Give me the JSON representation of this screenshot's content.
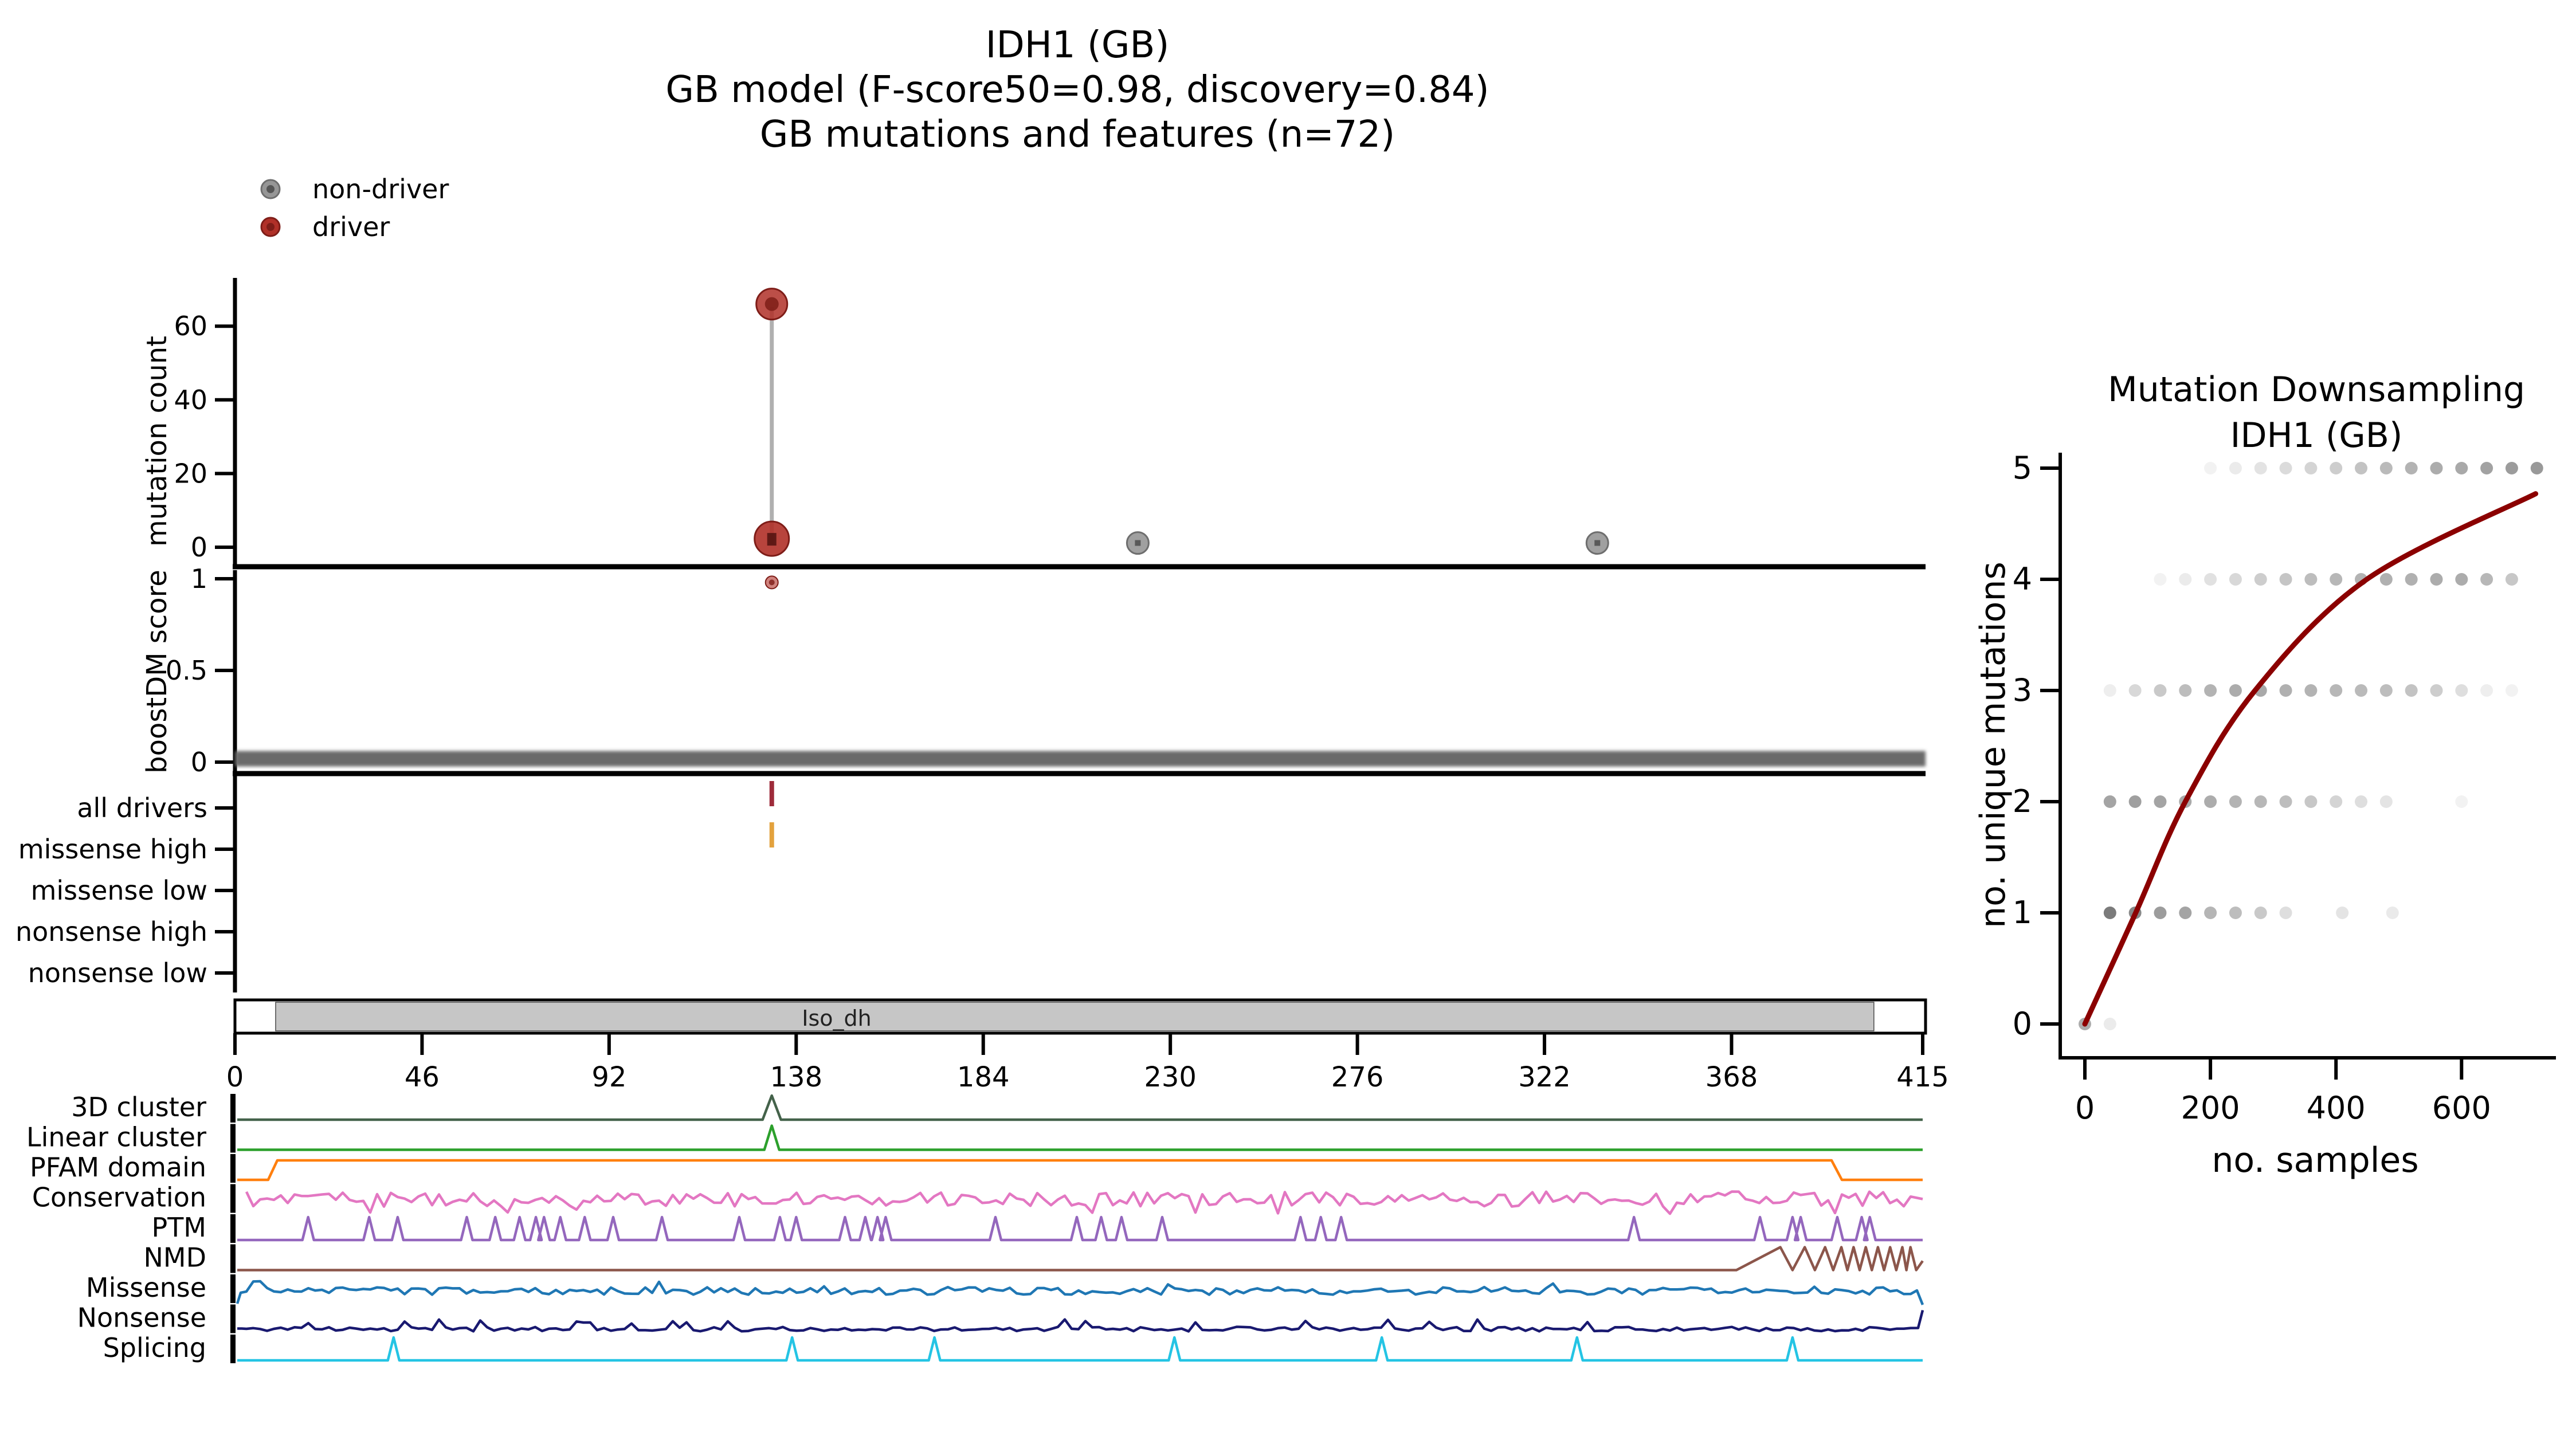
{
  "title": {
    "lines": [
      "IDH1 (GB)",
      "GB model (F-score50=0.98, discovery=0.84)",
      "GB mutations and features (n=72)"
    ]
  },
  "legend": {
    "items": [
      {
        "label": "non-driver",
        "color": "#969696"
      },
      {
        "label": "driver",
        "color": "#b03028"
      }
    ]
  },
  "colors": {
    "driver": "#b03028",
    "driver_dark": "#7e1d18",
    "non_driver": "#969696",
    "stem": "#b0b0b0",
    "score_band": "#6a6a6a",
    "axis": "#000000",
    "domain_fill": "#c6c6c6",
    "downsampling_curve": "#8b0000",
    "downsampling_dot": "#5a5a5a"
  },
  "chart_data": [
    {
      "id": "mutation_count_needle",
      "type": "scatter",
      "ylabel": "mutation count",
      "yticks": [
        0,
        20,
        40,
        60
      ],
      "xlim": [
        0,
        415
      ],
      "driver_points": [
        {
          "pos": 132,
          "count": 66
        },
        {
          "pos": 132,
          "count": 2
        }
      ],
      "nondriver_points": [
        {
          "pos": 222,
          "count": 1
        },
        {
          "pos": 335,
          "count": 1
        }
      ]
    },
    {
      "id": "boostdm_score",
      "type": "scatter",
      "ylabel": "boostDM score",
      "yticks": [
        {
          "label": "0",
          "value": 0
        },
        {
          "label": "0.5",
          "value": 0.5
        },
        {
          "label": "1",
          "value": 1
        }
      ],
      "band": {
        "score": 0.02,
        "color": "#6a6a6a",
        "extent": [
          0,
          415
        ]
      },
      "driver_points": [
        {
          "pos": 132,
          "score": 0.98
        }
      ]
    },
    {
      "id": "observed_mutations",
      "type": "ticks",
      "rows": [
        "all drivers",
        "missense high",
        "missense low",
        "nonsense high",
        "nonsense low"
      ],
      "marks": [
        {
          "row": 0,
          "pos": 132,
          "color": "#9e2b3a"
        },
        {
          "row": 1,
          "pos": 132,
          "color": "#e3a23d"
        }
      ]
    },
    {
      "id": "protein_domain_axis",
      "type": "table",
      "domain": {
        "label": "Iso_dh",
        "start": 10,
        "end": 403
      },
      "xticks": [
        0,
        46,
        92,
        138,
        184,
        230,
        276,
        322,
        368,
        415
      ],
      "xlim": [
        0,
        415
      ]
    },
    {
      "id": "feature_tracks",
      "type": "line",
      "tracks": [
        {
          "name": "3D cluster",
          "color": "#44624a",
          "kind": "spike",
          "spikes": [
            132
          ]
        },
        {
          "name": "Linear cluster",
          "color": "#2ca02c",
          "kind": "spike",
          "spikes": [
            132
          ]
        },
        {
          "name": "PFAM domain",
          "color": "#ff7f0e",
          "kind": "step",
          "step_up": 9,
          "step_down": 394
        },
        {
          "name": "Conservation",
          "color": "#e377c2",
          "kind": "noise",
          "seed": 7,
          "amp": 26
        },
        {
          "name": "PTM",
          "color": "#9467bd",
          "kind": "spikes",
          "spikes": [
            18,
            33,
            40,
            57,
            64,
            70,
            74,
            76,
            80,
            86,
            93,
            105,
            124,
            134,
            138,
            150,
            155,
            158,
            160,
            187,
            207,
            213,
            218,
            228,
            262,
            267,
            272,
            344,
            375,
            383,
            385,
            394,
            400,
            402
          ]
        },
        {
          "name": "NMD",
          "color": "#8c564b",
          "kind": "endosc",
          "osc_start": 372,
          "peaks": [
            380,
            386,
            391,
            395,
            398,
            401,
            404,
            407,
            410,
            412
          ]
        },
        {
          "name": "Missense",
          "color": "#1f77b4",
          "kind": "noise",
          "seed": 13,
          "amp": 13
        },
        {
          "name": "Nonsense",
          "color": "#191970",
          "kind": "noise",
          "seed": 21,
          "amp": 8
        },
        {
          "name": "Splicing",
          "color": "#24c4e4",
          "kind": "spikes",
          "spikes": [
            39,
            137,
            172,
            231,
            282,
            330,
            383
          ]
        }
      ]
    },
    {
      "id": "downsampling",
      "type": "scatter",
      "title": [
        "Mutation Downsampling",
        "IDH1 (GB)"
      ],
      "xlabel": "no. samples",
      "ylabel": "no. unique mutations",
      "xticks": [
        0,
        200,
        400,
        600
      ],
      "yticks": [
        0,
        1,
        2,
        3,
        4,
        5
      ],
      "xlim": [
        0,
        740
      ],
      "ylim": [
        0,
        5.3
      ],
      "curve_color": "#8b0000",
      "curve": [
        [
          0,
          0
        ],
        [
          81,
          1
        ],
        [
          160,
          2
        ],
        [
          271,
          3
        ],
        [
          449,
          4
        ],
        [
          718,
          4.77
        ]
      ],
      "dot_rows": [
        {
          "unique": 0,
          "points": [
            [
              0,
              0.5
            ],
            [
              40,
              0.12
            ]
          ]
        },
        {
          "unique": 1,
          "points": [
            [
              40,
              0.8
            ],
            [
              80,
              0.72
            ],
            [
              120,
              0.6
            ],
            [
              160,
              0.55
            ],
            [
              200,
              0.45
            ],
            [
              240,
              0.4
            ],
            [
              280,
              0.33
            ],
            [
              320,
              0.2
            ],
            [
              410,
              0.16
            ],
            [
              490,
              0.13
            ]
          ]
        },
        {
          "unique": 2,
          "points": [
            [
              40,
              0.55
            ],
            [
              80,
              0.58
            ],
            [
              120,
              0.55
            ],
            [
              160,
              0.52
            ],
            [
              200,
              0.5
            ],
            [
              240,
              0.46
            ],
            [
              280,
              0.44
            ],
            [
              320,
              0.4
            ],
            [
              360,
              0.34
            ],
            [
              400,
              0.26
            ],
            [
              440,
              0.2
            ],
            [
              480,
              0.16
            ],
            [
              600,
              0.08
            ]
          ]
        },
        {
          "unique": 3,
          "points": [
            [
              40,
              0.1
            ],
            [
              80,
              0.24
            ],
            [
              120,
              0.33
            ],
            [
              160,
              0.4
            ],
            [
              200,
              0.46
            ],
            [
              240,
              0.5
            ],
            [
              280,
              0.52
            ],
            [
              320,
              0.48
            ],
            [
              360,
              0.46
            ],
            [
              400,
              0.44
            ],
            [
              440,
              0.42
            ],
            [
              480,
              0.4
            ],
            [
              520,
              0.36
            ],
            [
              560,
              0.3
            ],
            [
              600,
              0.2
            ],
            [
              640,
              0.1
            ],
            [
              680,
              0.08
            ]
          ]
        },
        {
          "unique": 4,
          "points": [
            [
              120,
              0.08
            ],
            [
              160,
              0.12
            ],
            [
              200,
              0.18
            ],
            [
              240,
              0.24
            ],
            [
              280,
              0.3
            ],
            [
              320,
              0.35
            ],
            [
              360,
              0.4
            ],
            [
              400,
              0.44
            ],
            [
              440,
              0.46
            ],
            [
              480,
              0.48
            ],
            [
              520,
              0.48
            ],
            [
              560,
              0.5
            ],
            [
              600,
              0.5
            ],
            [
              640,
              0.44
            ],
            [
              680,
              0.34
            ]
          ]
        },
        {
          "unique": 5,
          "points": [
            [
              200,
              0.08
            ],
            [
              240,
              0.12
            ],
            [
              280,
              0.17
            ],
            [
              320,
              0.22
            ],
            [
              360,
              0.26
            ],
            [
              400,
              0.3
            ],
            [
              440,
              0.36
            ],
            [
              480,
              0.42
            ],
            [
              520,
              0.46
            ],
            [
              560,
              0.5
            ],
            [
              600,
              0.52
            ],
            [
              640,
              0.56
            ],
            [
              680,
              0.6
            ],
            [
              720,
              0.62
            ]
          ]
        }
      ]
    }
  ]
}
